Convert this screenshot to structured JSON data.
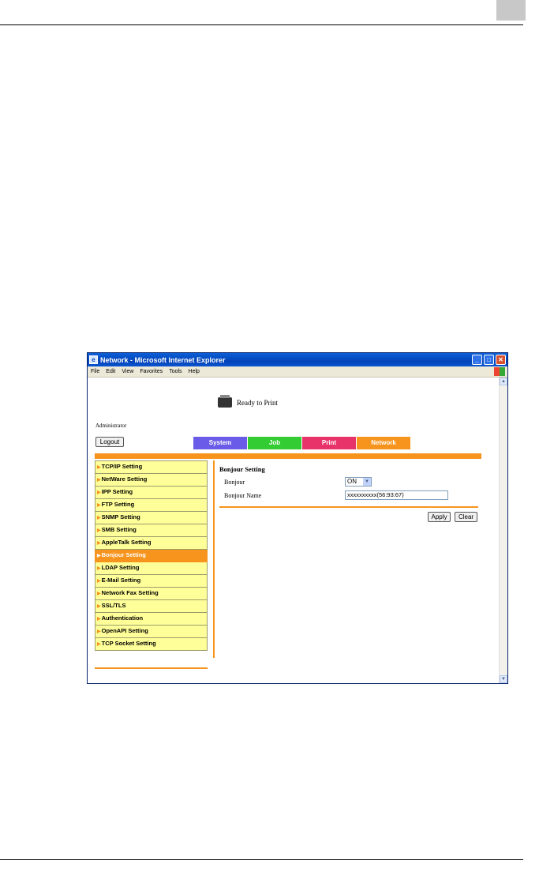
{
  "window": {
    "title": "Network - Microsoft Internet Explorer",
    "minimize_glyph": "_",
    "maximize_glyph": "□",
    "close_glyph": "✕"
  },
  "menu": [
    "File",
    "Edit",
    "View",
    "Favorites",
    "Tools",
    "Help"
  ],
  "status": {
    "text": "Ready to Print"
  },
  "user": {
    "label": "Administrator"
  },
  "logout_label": "Logout",
  "tabs": [
    {
      "label": "System",
      "color": "#6a5ce8"
    },
    {
      "label": "Job",
      "color": "#33cc33"
    },
    {
      "label": "Print",
      "color": "#e8336a"
    },
    {
      "label": "Network",
      "color": "#f7941d"
    }
  ],
  "sidebar": {
    "items": [
      {
        "label": "TCP/IP Setting"
      },
      {
        "label": "NetWare Setting"
      },
      {
        "label": "IPP Setting"
      },
      {
        "label": "FTP Setting"
      },
      {
        "label": "SNMP Setting"
      },
      {
        "label": "SMB Setting"
      },
      {
        "label": "AppleTalk Setting"
      },
      {
        "label": "Bonjour Setting"
      },
      {
        "label": "LDAP Setting"
      },
      {
        "label": "E-Mail Setting"
      },
      {
        "label": "Network Fax Setting"
      },
      {
        "label": "SSL/TLS"
      },
      {
        "label": "Authentication"
      },
      {
        "label": "OpenAPI Setting"
      },
      {
        "label": "TCP Socket Setting"
      }
    ],
    "active_index": 7
  },
  "main": {
    "heading": "Bonjour Setting",
    "bonjour_label": "Bonjour",
    "bonjour_value": "ON",
    "name_label": "Bonjour Name",
    "name_value": "xxxxxxxxxx(56:93:67)",
    "apply_label": "Apply",
    "clear_label": "Clear"
  }
}
